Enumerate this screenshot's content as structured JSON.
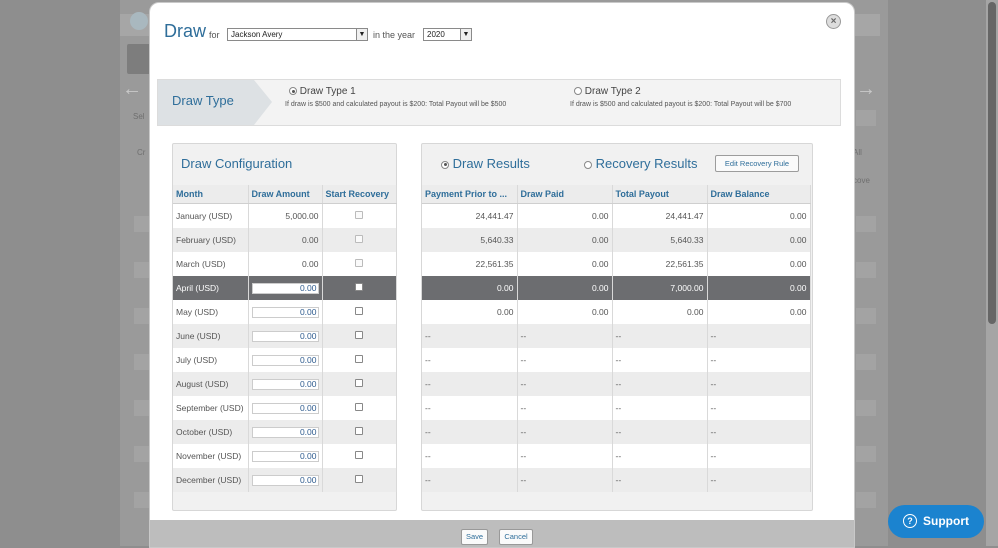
{
  "header": {
    "title": "Draw",
    "for_label": "for",
    "person": "Jackson Avery",
    "year_label": "in the year",
    "year": "2020"
  },
  "draw_type": {
    "label": "Draw Type",
    "options": [
      {
        "title": "Draw Type 1",
        "desc": "If draw is $500 and calculated payout is $200: Total Payout will be $500",
        "selected": true
      },
      {
        "title": "Draw Type 2",
        "desc": "If draw is $500 and calculated payout is $200: Total Payout will be $700",
        "selected": false
      }
    ]
  },
  "config": {
    "title": "Draw Configuration",
    "columns": [
      "Month",
      "Draw Amount",
      "Start Recovery"
    ],
    "rows": [
      {
        "month": "January (USD)",
        "amount": "5,000.00",
        "editable": false
      },
      {
        "month": "February (USD)",
        "amount": "0.00",
        "editable": false
      },
      {
        "month": "March (USD)",
        "amount": "0.00",
        "editable": false
      },
      {
        "month": "April (USD)",
        "amount": "0.00",
        "editable": true
      },
      {
        "month": "May (USD)",
        "amount": "0.00",
        "editable": true
      },
      {
        "month": "June (USD)",
        "amount": "0.00",
        "editable": true
      },
      {
        "month": "July (USD)",
        "amount": "0.00",
        "editable": true
      },
      {
        "month": "August (USD)",
        "amount": "0.00",
        "editable": true
      },
      {
        "month": "September (USD)",
        "amount": "0.00",
        "editable": true
      },
      {
        "month": "October (USD)",
        "amount": "0.00",
        "editable": true
      },
      {
        "month": "November (USD)",
        "amount": "0.00",
        "editable": true
      },
      {
        "month": "December (USD)",
        "amount": "0.00",
        "editable": true
      }
    ]
  },
  "results": {
    "tab_draw": "Draw Results",
    "tab_recovery": "Recovery Results",
    "edit_button": "Edit Recovery Rule",
    "columns": [
      "Payment Prior to ...",
      "Draw Paid",
      "Total Payout",
      "Draw Balance"
    ],
    "rows": [
      [
        "24,441.47",
        "0.00",
        "24,441.47",
        "0.00"
      ],
      [
        "5,640.33",
        "0.00",
        "5,640.33",
        "0.00"
      ],
      [
        "22,561.35",
        "0.00",
        "22,561.35",
        "0.00"
      ],
      [
        "0.00",
        "0.00",
        "7,000.00",
        "0.00"
      ],
      [
        "0.00",
        "0.00",
        "0.00",
        "0.00"
      ],
      [
        "--",
        "--",
        "--",
        "--"
      ],
      [
        "--",
        "--",
        "--",
        "--"
      ],
      [
        "--",
        "--",
        "--",
        "--"
      ],
      [
        "--",
        "--",
        "--",
        "--"
      ],
      [
        "--",
        "--",
        "--",
        "--"
      ],
      [
        "--",
        "--",
        "--",
        "--"
      ],
      [
        "--",
        "--",
        "--",
        "--"
      ]
    ]
  },
  "footer": {
    "save": "Save",
    "cancel": "Cancel"
  },
  "support": {
    "label": "Support"
  },
  "background": {
    "sel": "Sel",
    "cr": "Cr",
    "all": "All",
    "cove": "cove"
  },
  "colors": {
    "accent": "#2f6e9a",
    "selected_row": "#6c6d70",
    "support": "#1b83cf"
  }
}
